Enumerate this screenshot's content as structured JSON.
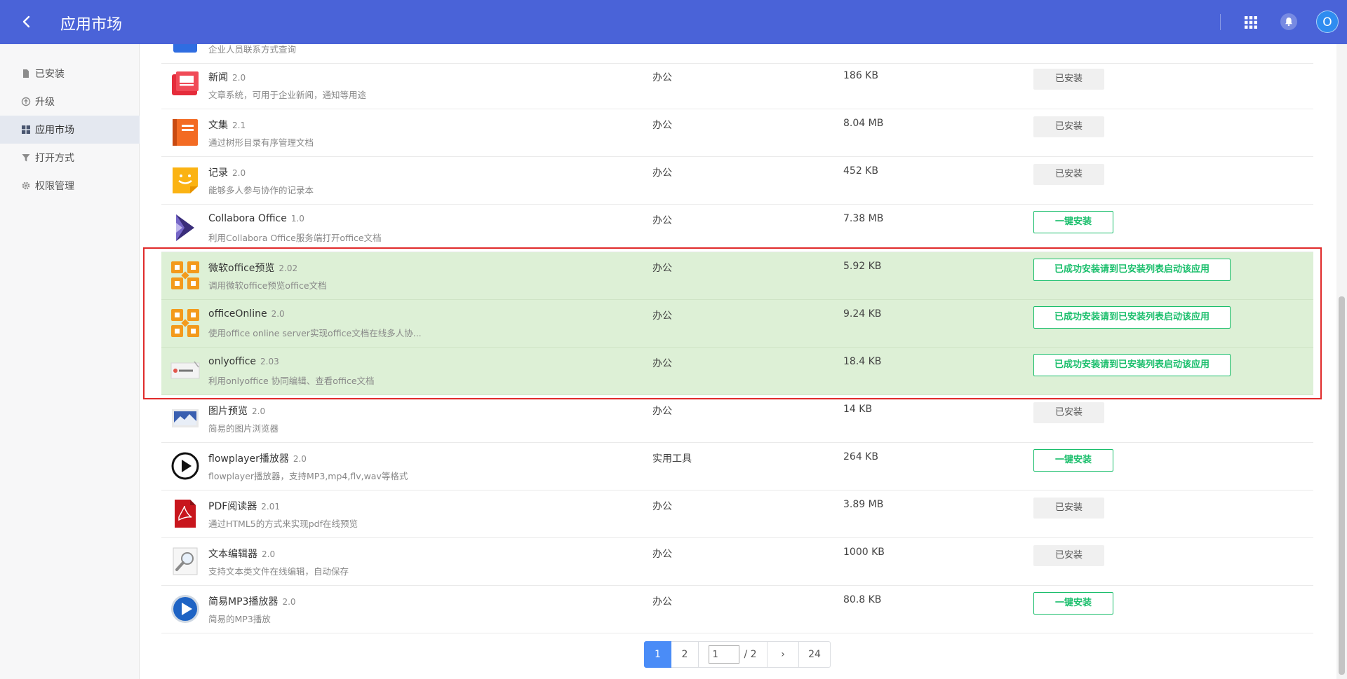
{
  "header": {
    "title": "应用市场",
    "avatar_letter": "O"
  },
  "sidebar": {
    "items": [
      {
        "label": "已安装",
        "icon": "file-icon"
      },
      {
        "label": "升级",
        "icon": "upgrade-circle-icon"
      },
      {
        "label": "应用市场",
        "icon": "grid-icon"
      },
      {
        "label": "打开方式",
        "icon": "filter-icon"
      },
      {
        "label": "权限管理",
        "icon": "gear-icon"
      }
    ],
    "active_index": 2
  },
  "partial_row": {
    "desc": "企业人员联系方式查询"
  },
  "apps": [
    {
      "name": "新闻",
      "version": "2.0",
      "desc": "文章系统，可用于企业新闻，通知等用途",
      "category": "办公",
      "size": "186 KB",
      "status": "已安装",
      "icon": "news-icon",
      "highlight": false
    },
    {
      "name": "文集",
      "version": "2.1",
      "desc": "通过树形目录有序管理文档",
      "category": "办公",
      "size": "8.04 MB",
      "status": "已安装",
      "icon": "notebook-icon",
      "highlight": false
    },
    {
      "name": "记录",
      "version": "2.0",
      "desc": "能够多人参与协作的记录本",
      "category": "办公",
      "size": "452 KB",
      "status": "已安装",
      "icon": "smiley-note-icon",
      "highlight": false
    },
    {
      "name": "Collabora Office",
      "version": "1.0",
      "desc": "利用Collabora Office服务端打开office文档",
      "category": "办公",
      "size": "7.38 MB",
      "status": "一键安装",
      "icon": "collabora-icon",
      "highlight": false
    },
    {
      "name": "微软office预览",
      "version": "2.02",
      "desc": "调用微软office预览office文档",
      "category": "办公",
      "size": "5.92 KB",
      "status": "已成功安装请到已安装列表启动该应用",
      "icon": "ms-office-icon",
      "highlight": true
    },
    {
      "name": "officeOnline",
      "version": "2.0",
      "desc": "使用office online server实现office文档在线多人协...",
      "category": "办公",
      "size": "9.24 KB",
      "status": "已成功安装请到已安装列表启动该应用",
      "icon": "ms-office-icon",
      "highlight": true
    },
    {
      "name": "onlyoffice",
      "version": "2.03",
      "desc": "利用onlyoffice 协同编辑、查看office文档",
      "category": "办公",
      "size": "18.4 KB",
      "status": "已成功安装请到已安装列表启动该应用",
      "icon": "onlyoffice-icon",
      "highlight": true
    },
    {
      "name": "图片预览",
      "version": "2.0",
      "desc": "简易的图片浏览器",
      "category": "办公",
      "size": "14 KB",
      "status": "已安装",
      "icon": "image-preview-icon",
      "highlight": false
    },
    {
      "name": "flowplayer播放器",
      "version": "2.0",
      "desc": "flowplayer播放器，支持MP3,mp4,flv,wav等格式",
      "category": "实用工具",
      "size": "264 KB",
      "status": "一键安装",
      "icon": "play-icon",
      "highlight": false
    },
    {
      "name": "PDF阅读器",
      "version": "2.01",
      "desc": "通过HTML5的方式来实现pdf在线预览",
      "category": "办公",
      "size": "3.89 MB",
      "status": "已安装",
      "icon": "pdf-icon",
      "highlight": false
    },
    {
      "name": "文本编辑器",
      "version": "2.0",
      "desc": "支持文本类文件在线编辑，自动保存",
      "category": "办公",
      "size": "1000 KB",
      "status": "已安装",
      "icon": "magnifier-doc-icon",
      "highlight": false
    },
    {
      "name": "简易MP3播放器",
      "version": "2.0",
      "desc": "简易的MP3播放",
      "category": "办公",
      "size": "80.8 KB",
      "status": "一键安装",
      "icon": "mp3-play-icon",
      "highlight": false
    }
  ],
  "pagination": {
    "current": "1",
    "next_page": "2",
    "input_value": "1",
    "total_label": "/ 2",
    "next_icon": "›",
    "per_page": "24"
  },
  "colors": {
    "header_bg": "#4a63d8",
    "highlight_bg": "#ddf0d6",
    "install_green": "#19be6b",
    "annotation_red": "#e02b2b",
    "pager_active": "#4a8cf7"
  }
}
